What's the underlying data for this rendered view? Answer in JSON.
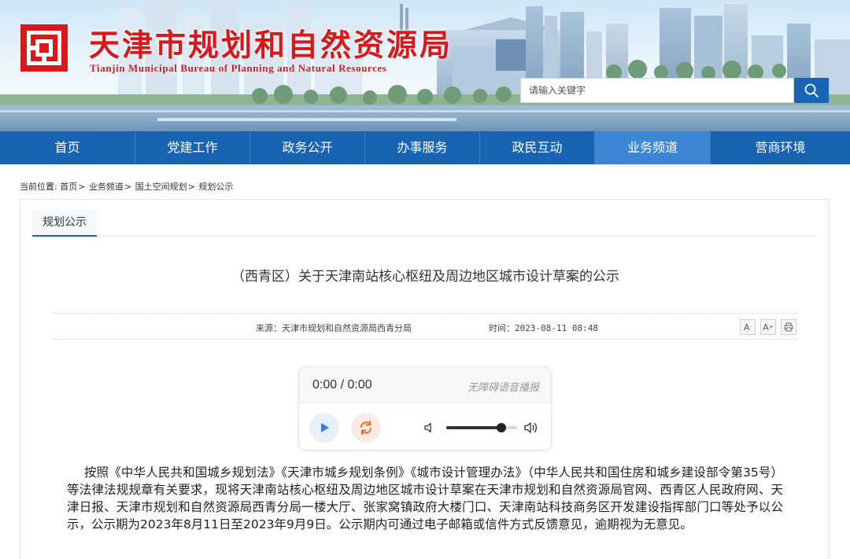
{
  "header": {
    "title": "天津市规划和自然资源局",
    "subtitle": "Tianjin Municipal Bureau of Planning and Natural Resources",
    "search_placeholder": "请输入关键字"
  },
  "nav": {
    "items": [
      {
        "label": "首页",
        "active": false
      },
      {
        "label": "党建工作",
        "active": false
      },
      {
        "label": "政务公开",
        "active": false
      },
      {
        "label": "办事服务",
        "active": false
      },
      {
        "label": "政民互动",
        "active": false
      },
      {
        "label": "业务频道",
        "active": true
      },
      {
        "label": "营商环境",
        "active": false
      }
    ]
  },
  "breadcrumb": {
    "prefix": "当前位置:",
    "items": [
      "首页",
      "业务频道",
      "国土空间规划",
      "规划公示"
    ]
  },
  "tab": {
    "label": "规划公示"
  },
  "article": {
    "title": "（西青区）关于天津南站核心枢纽及周边地区城市设计草案的公示",
    "source": "来源：天津市规划和自然资源局西青分局",
    "time": "时间：2023-08-11 08:48",
    "tools": {
      "font_smaller": "A",
      "font_larger": "A"
    },
    "body": "按照《中华人民共和国城乡规划法》《天津市城乡规划条例》《城市设计管理办法》（中华人民共和国住房和城乡建设部令第35号）等法律法规规章有关要求，现将天津南站核心枢纽及周边地区城市设计草案在天津市规划和自然资源局官网、西青区人民政府网、天津日报、天津市规划和自然资源局西青分局一楼大厅、张家窝镇政府大楼门口、天津南站科技商务区开发建设指挥部门口等处予以公示，公示期为2023年8月11日至2023年9月9日。公示期内可通过电子邮箱或信件方式反馈意见，逾期视为无意见。"
  },
  "player": {
    "time": "0:00 / 0:00",
    "label": "无障碍语音播报",
    "volume": 0.78
  },
  "colors": {
    "brand_red": "#d7191b",
    "nav_blue": "#1963b3",
    "nav_active": "#3d86d6"
  }
}
